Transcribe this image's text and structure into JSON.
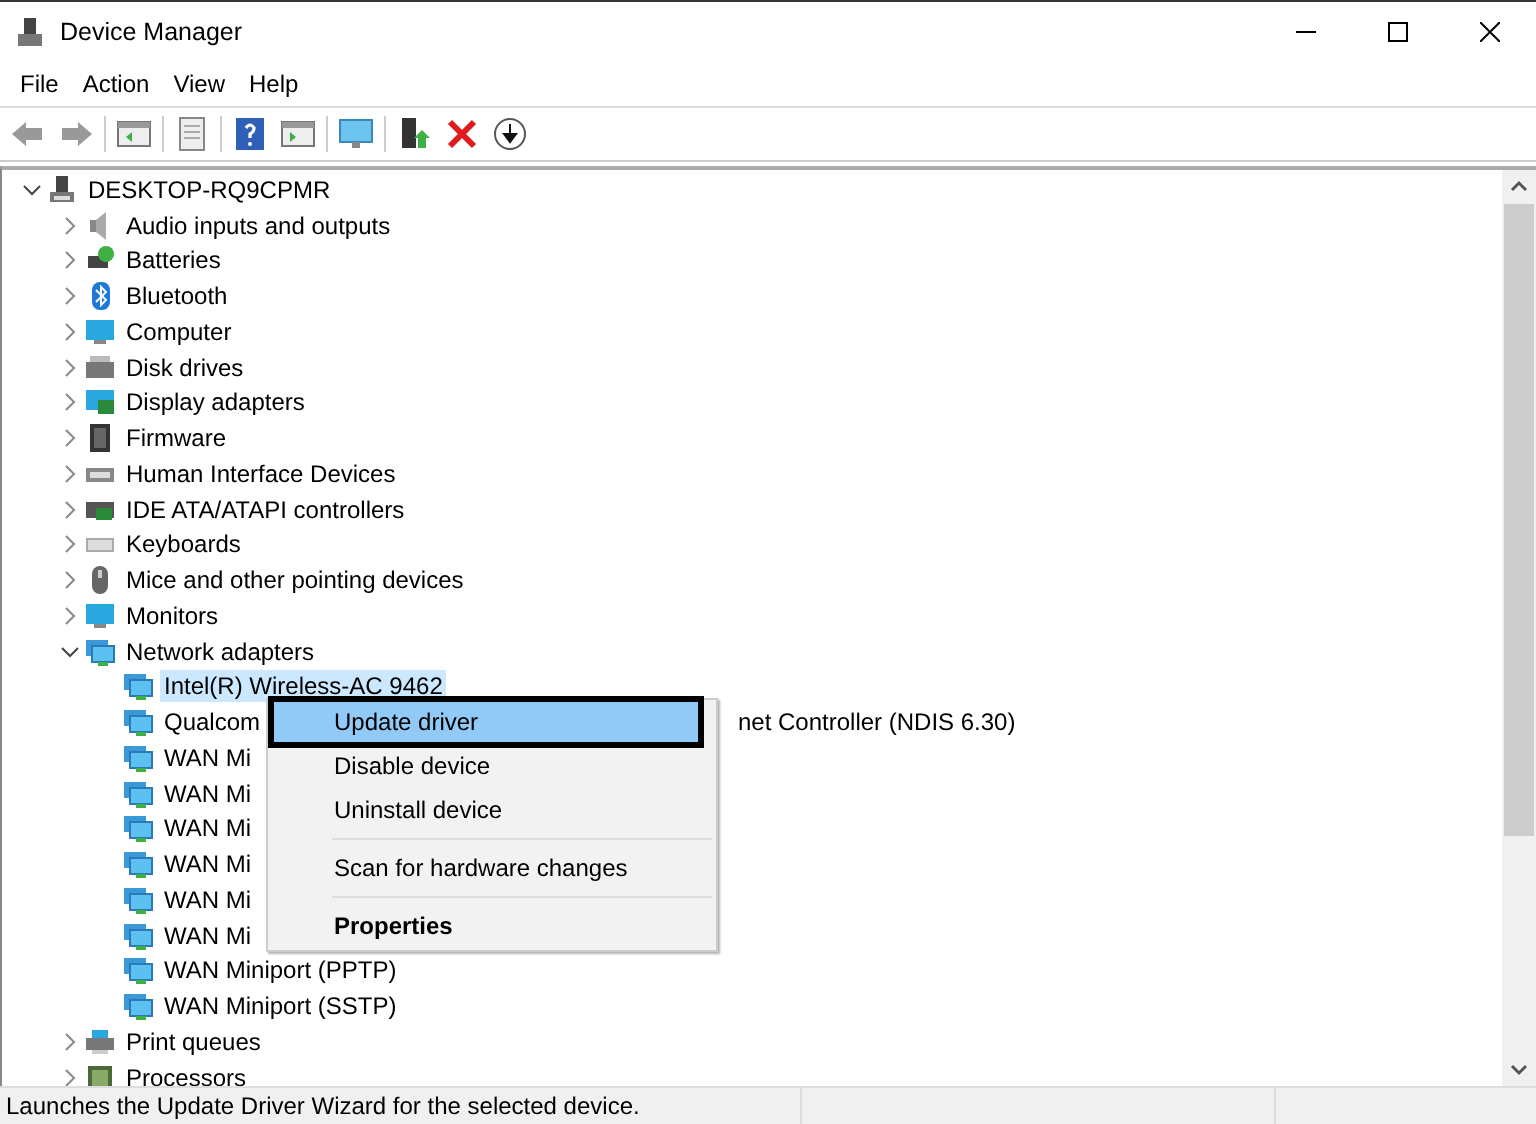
{
  "window": {
    "title": "Device Manager"
  },
  "menu_bar": [
    "File",
    "Action",
    "View",
    "Help"
  ],
  "tree": {
    "label": "DESKTOP-RQ9CPMR",
    "expanded": true,
    "children": [
      {
        "label": "Audio inputs and outputs",
        "expanded": false
      },
      {
        "label": "Batteries",
        "expanded": false
      },
      {
        "label": "Bluetooth",
        "expanded": false
      },
      {
        "label": "Computer",
        "expanded": false
      },
      {
        "label": "Disk drives",
        "expanded": false
      },
      {
        "label": "Display adapters",
        "expanded": false
      },
      {
        "label": "Firmware",
        "expanded": false
      },
      {
        "label": "Human Interface Devices",
        "expanded": false
      },
      {
        "label": "IDE ATA/ATAPI controllers",
        "expanded": false
      },
      {
        "label": "Keyboards",
        "expanded": false
      },
      {
        "label": "Mice and other pointing devices",
        "expanded": false
      },
      {
        "label": "Monitors",
        "expanded": false
      },
      {
        "label": "Network adapters",
        "expanded": true,
        "children": [
          {
            "label": "Intel(R) Wireless-AC 9462",
            "selected": true
          },
          {
            "label": "Qualcom",
            "label_right": "net Controller (NDIS 6.30)",
            "selected": false
          },
          {
            "label": "WAN Mi",
            "selected": false
          },
          {
            "label": "WAN Mi",
            "selected": false
          },
          {
            "label": "WAN Mi",
            "selected": false
          },
          {
            "label": "WAN Mi",
            "selected": false
          },
          {
            "label": "WAN Mi",
            "selected": false
          },
          {
            "label": "WAN Mi",
            "selected": false
          },
          {
            "label": "WAN Miniport (PPTP)",
            "selected": false
          },
          {
            "label": "WAN Miniport (SSTP)",
            "selected": false
          }
        ]
      },
      {
        "label": "Print queues",
        "expanded": false
      },
      {
        "label": "Processors",
        "expanded": false
      }
    ]
  },
  "context_menu": [
    {
      "kind": "item",
      "label": "Update driver",
      "selected": true,
      "outlined": true
    },
    {
      "kind": "item",
      "label": "Disable device",
      "selected": false
    },
    {
      "kind": "item",
      "label": "Uninstall device",
      "selected": false
    },
    {
      "kind": "separator"
    },
    {
      "kind": "item",
      "label": "Scan for hardware changes",
      "selected": false
    },
    {
      "kind": "separator"
    },
    {
      "kind": "item",
      "label": "Properties",
      "selected": false,
      "default": true
    }
  ],
  "status_bar": {
    "text": "Launches the Update Driver Wizard for the selected device."
  }
}
